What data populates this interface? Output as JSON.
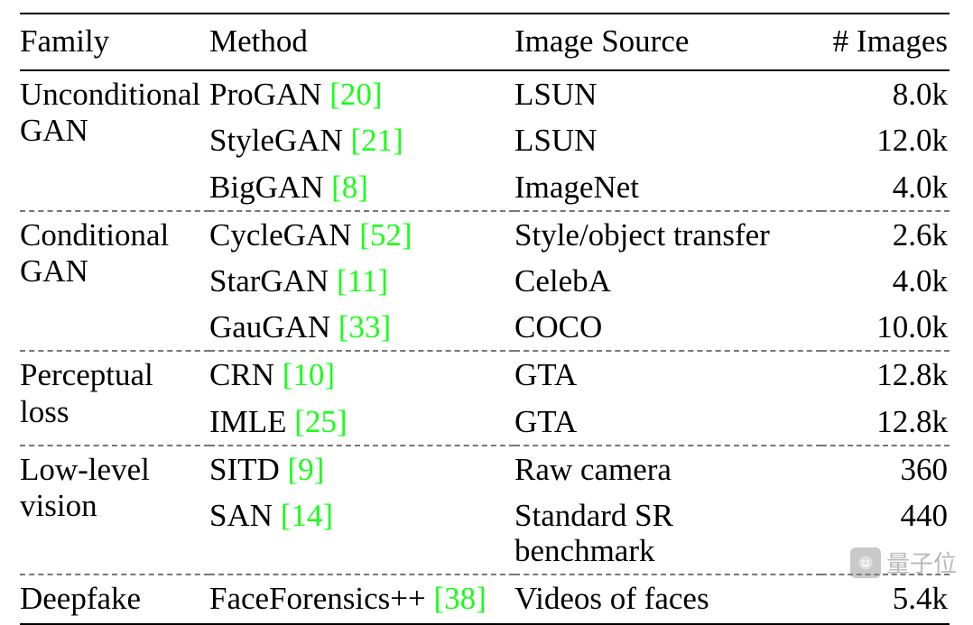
{
  "headers": {
    "family": "Family",
    "method": "Method",
    "source": "Image Source",
    "images": "# Images"
  },
  "groups": [
    {
      "family_lines": [
        "Unconditional",
        "GAN"
      ],
      "rows": [
        {
          "method": "ProGAN",
          "cite": "[20]",
          "source": "LSUN",
          "images": "8.0k"
        },
        {
          "method": "StyleGAN",
          "cite": "[21]",
          "source": "LSUN",
          "images": "12.0k"
        },
        {
          "method": "BigGAN",
          "cite": "[8]",
          "source": "ImageNet",
          "images": "4.0k"
        }
      ]
    },
    {
      "family_lines": [
        "Conditional",
        "GAN"
      ],
      "rows": [
        {
          "method": "CycleGAN",
          "cite": "[52]",
          "source": "Style/object transfer",
          "images": "2.6k"
        },
        {
          "method": "StarGAN",
          "cite": "[11]",
          "source": "CelebA",
          "images": "4.0k"
        },
        {
          "method": "GauGAN",
          "cite": "[33]",
          "source": "COCO",
          "images": "10.0k"
        }
      ]
    },
    {
      "family_lines": [
        "Perceptual",
        "loss"
      ],
      "rows": [
        {
          "method": "CRN",
          "cite": "[10]",
          "source": "GTA",
          "images": "12.8k"
        },
        {
          "method": "IMLE",
          "cite": "[25]",
          "source": "GTA",
          "images": "12.8k"
        }
      ]
    },
    {
      "family_lines": [
        "Low-level",
        "vision"
      ],
      "rows": [
        {
          "method": "SITD",
          "cite": "[9]",
          "source": "Raw camera",
          "images": "360"
        },
        {
          "method": "SAN",
          "cite": "[14]",
          "source": "Standard SR benchmark",
          "images": "440"
        }
      ]
    },
    {
      "family_lines": [
        "Deepfake"
      ],
      "rows": [
        {
          "method": "FaceForensics++",
          "cite": "[38]",
          "source": "Videos of faces",
          "images": "5.4k"
        }
      ]
    }
  ],
  "watermark": {
    "text": "量子位"
  },
  "chart_data": {
    "type": "table",
    "title": "",
    "columns": [
      "Family",
      "Method",
      "Citation",
      "Image Source",
      "# Images"
    ],
    "rows": [
      [
        "Unconditional GAN",
        "ProGAN",
        "[20]",
        "LSUN",
        "8.0k"
      ],
      [
        "Unconditional GAN",
        "StyleGAN",
        "[21]",
        "LSUN",
        "12.0k"
      ],
      [
        "Unconditional GAN",
        "BigGAN",
        "[8]",
        "ImageNet",
        "4.0k"
      ],
      [
        "Conditional GAN",
        "CycleGAN",
        "[52]",
        "Style/object transfer",
        "2.6k"
      ],
      [
        "Conditional GAN",
        "StarGAN",
        "[11]",
        "CelebA",
        "4.0k"
      ],
      [
        "Conditional GAN",
        "GauGAN",
        "[33]",
        "COCO",
        "10.0k"
      ],
      [
        "Perceptual loss",
        "CRN",
        "[10]",
        "GTA",
        "12.8k"
      ],
      [
        "Perceptual loss",
        "IMLE",
        "[25]",
        "GTA",
        "12.8k"
      ],
      [
        "Low-level vision",
        "SITD",
        "[9]",
        "Raw camera",
        "360"
      ],
      [
        "Low-level vision",
        "SAN",
        "[14]",
        "Standard SR benchmark",
        "440"
      ],
      [
        "Deepfake",
        "FaceForensics++",
        "[38]",
        "Videos of faces",
        "5.4k"
      ]
    ]
  }
}
